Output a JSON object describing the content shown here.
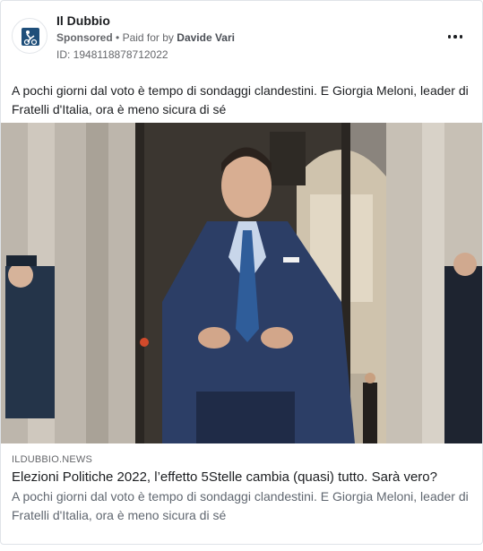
{
  "post": {
    "page_name": "Il Dubbio",
    "sponsored_label": "Sponsored",
    "separator": "•",
    "paid_for_prefix": "Paid for by",
    "paid_by": "Davide Vari",
    "ad_id_label": "ID: 1948118878712022",
    "body_text": "A pochi giorni dal voto è tempo di sondaggi clandestini. E Giorgia Meloni, leader di Fratelli d'Italia, ora è meno sicura di sé",
    "more_icon": "more-horizontal-icon",
    "avatar_icon": "il-dubbio-logo"
  },
  "link": {
    "domain": "ILDUBBIO.NEWS",
    "title": "Elezioni Politiche 2022, l’effetto 5Stelle cambia (quasi) tutto. Sarà vero?",
    "description": "A pochi giorni dal voto è tempo di sondaggi clandestini. E Giorgia Meloni, leader di Fratelli d'Italia, ora è meno sicura di sé"
  },
  "colors": {
    "brand": "#1f4f7a",
    "text_primary": "#1c1e21",
    "text_secondary": "#65676b"
  }
}
